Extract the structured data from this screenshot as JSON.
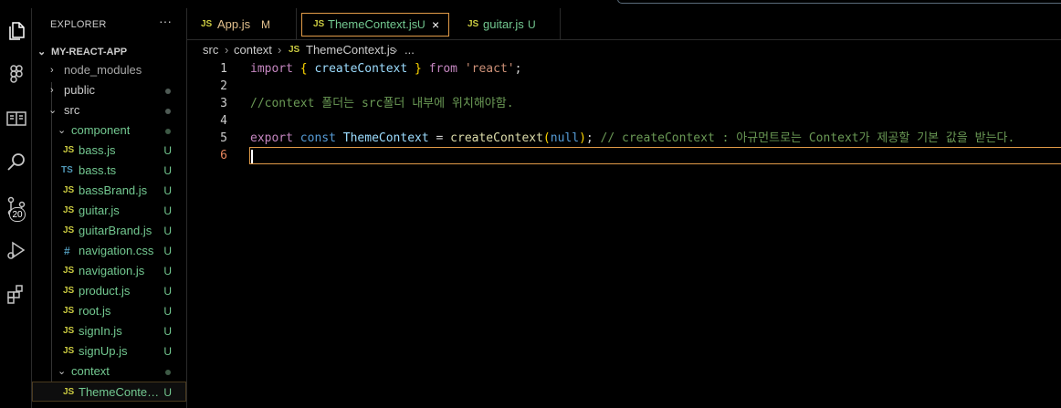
{
  "sidebar": {
    "title": "EXPLORER",
    "more": "···",
    "root": "MY-REACT-APP",
    "items": [
      {
        "label": "node_modules",
        "status": ""
      },
      {
        "label": "public",
        "status": ""
      },
      {
        "label": "src",
        "status": ""
      },
      {
        "label": "component",
        "status": ""
      },
      {
        "label": "bass.js",
        "status": "U",
        "icon": "JS"
      },
      {
        "label": "bass.ts",
        "status": "U",
        "icon": "TS"
      },
      {
        "label": "bassBrand.js",
        "status": "U",
        "icon": "JS"
      },
      {
        "label": "guitar.js",
        "status": "U",
        "icon": "JS"
      },
      {
        "label": "guitarBrand.js",
        "status": "U",
        "icon": "JS"
      },
      {
        "label": "navigation.css",
        "status": "U",
        "icon": "#"
      },
      {
        "label": "navigation.js",
        "status": "U",
        "icon": "JS"
      },
      {
        "label": "product.js",
        "status": "U",
        "icon": "JS"
      },
      {
        "label": "root.js",
        "status": "U",
        "icon": "JS"
      },
      {
        "label": "signIn.js",
        "status": "U",
        "icon": "JS"
      },
      {
        "label": "signUp.js",
        "status": "U",
        "icon": "JS"
      },
      {
        "label": "context",
        "status": ""
      },
      {
        "label": "ThemeContext.js",
        "status": "U",
        "icon": "JS"
      }
    ]
  },
  "activity": {
    "scm_badge": "20"
  },
  "tabs": [
    {
      "icon": "JS",
      "label": "App.js",
      "status": "M"
    },
    {
      "icon": "JS",
      "label": "ThemeContext.js",
      "status": "U",
      "close": "×"
    },
    {
      "icon": "JS",
      "label": "guitar.js",
      "status": "U"
    }
  ],
  "breadcrumb": {
    "part1": "src",
    "sep": "›",
    "part2": "context",
    "icon": "JS",
    "part3": "ThemeContext.js",
    "part4": "..."
  },
  "editor": {
    "line_numbers": [
      "1",
      "2",
      "3",
      "4",
      "5",
      "6"
    ],
    "line1": {
      "import": "import",
      "ob": "{",
      "name": "createContext",
      "cb": "}",
      "from": "from",
      "str": "'react'",
      "semi": ";"
    },
    "line3": "//context 폴더는 src폴더 내부에 위치해야함.",
    "line5": {
      "export": "export",
      "const": "const",
      "name": "ThemeContext",
      "eq": " = ",
      "fn": "createContext",
      "op": "(",
      "null": "null",
      "cp": ")",
      "semi": ";",
      "comment": " // createContext : 아규먼트로는 Context가 제공할 기본 값을 받는다."
    }
  },
  "colors": {
    "accent": "#e19b48",
    "untracked": "#73c991",
    "js_icon": "#cbcb41",
    "ts_icon": "#519aba",
    "css_icon": "#519aba"
  }
}
